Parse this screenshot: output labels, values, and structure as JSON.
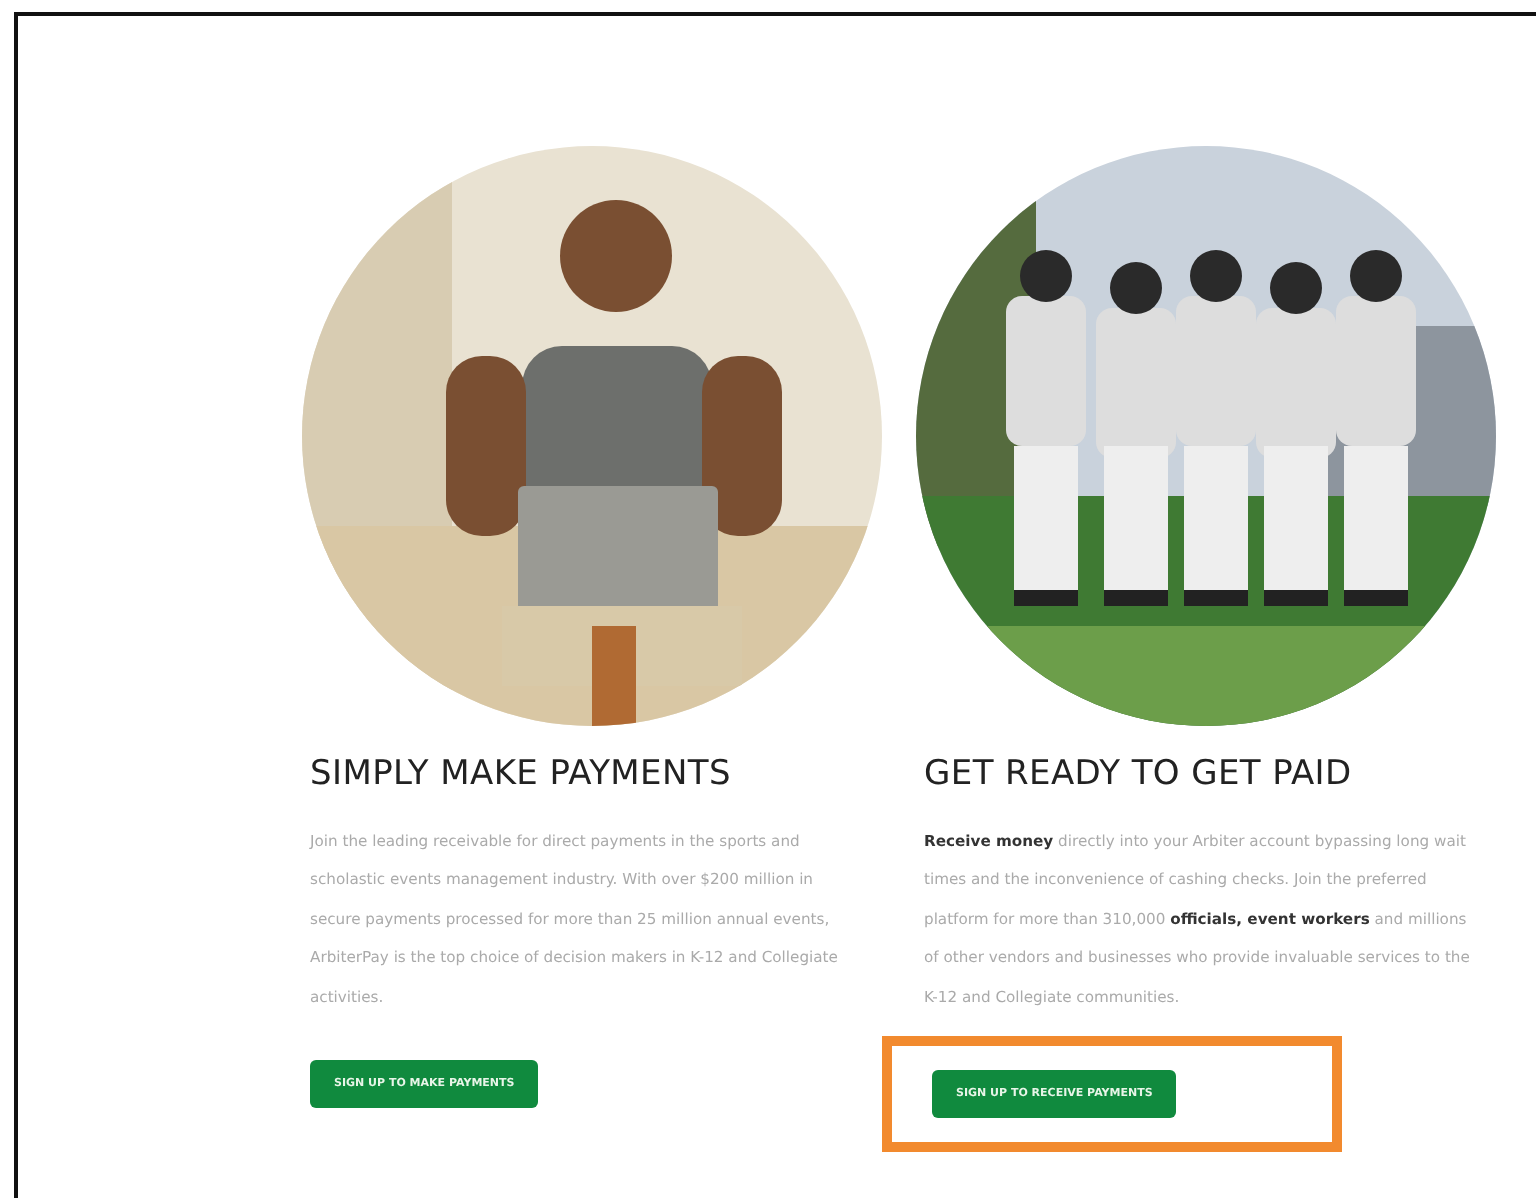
{
  "columns": [
    {
      "heading": "SIMPLY MAKE PAYMENTS",
      "body": "Join the leading receivable for direct payments in the sports and scholastic events management industry. With over $200 million in secure payments processed for more than 25 million annual events, ArbiterPay is the top choice of decision makers in K-12 and Collegiate activities.",
      "button": {
        "label": "SIGN UP TO MAKE PAYMENTS",
        "highlighted": false
      }
    },
    {
      "heading": "GET READY TO GET PAID",
      "body": "**Receive money** directly into your Arbiter account bypassing long wait times and the inconvenience of cashing checks. Join the preferred platform for more than 310,000 **officials, event workers** and millions of other vendors and businesses who provide invaluable services to the K-12 and Collegiate communities.",
      "button": {
        "label": "SIGN UP TO RECEIVE PAYMENTS",
        "highlighted": true
      }
    }
  ]
}
